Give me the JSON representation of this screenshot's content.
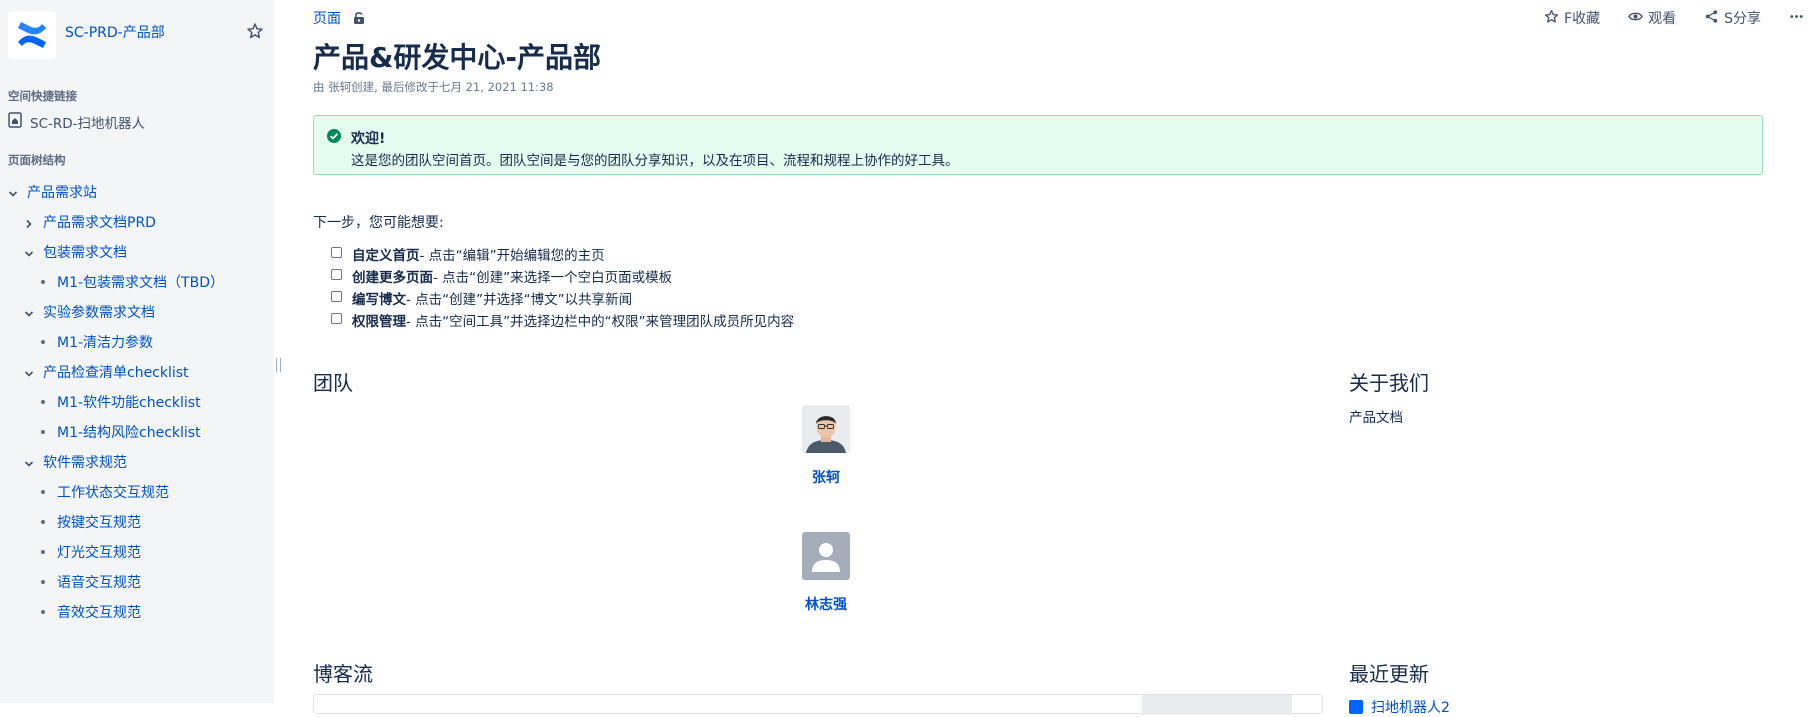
{
  "space": {
    "name": "SC-PRD-产品部",
    "logo_icon": "confluence-logo-icon"
  },
  "sidebar": {
    "shortcuts_heading": "空间快捷链接",
    "shortcut": {
      "label": "SC-RD-扫地机器人",
      "icon": "space-home-icon"
    },
    "tree_heading": "页面树结构",
    "tree": [
      {
        "label": "产品需求站",
        "level": 0,
        "marker": "chevron-down"
      },
      {
        "label": "产品需求文档PRD",
        "level": 1,
        "marker": "chevron-right"
      },
      {
        "label": "包装需求文档",
        "level": 1,
        "marker": "chevron-down"
      },
      {
        "label": "M1-包装需求文档（TBD）",
        "level": 2,
        "marker": "dot"
      },
      {
        "label": "实验参数需求文档",
        "level": 1,
        "marker": "chevron-down"
      },
      {
        "label": "M1-清洁力参数",
        "level": 2,
        "marker": "dot"
      },
      {
        "label": "产品检查清单checklist",
        "level": 1,
        "marker": "chevron-down"
      },
      {
        "label": "M1-软件功能checklist",
        "level": 2,
        "marker": "dot"
      },
      {
        "label": "M1-结构风险checklist",
        "level": 2,
        "marker": "dot"
      },
      {
        "label": "软件需求规范",
        "level": 1,
        "marker": "chevron-down"
      },
      {
        "label": "工作状态交互规范",
        "level": 2,
        "marker": "dot"
      },
      {
        "label": "按键交互规范",
        "level": 2,
        "marker": "dot"
      },
      {
        "label": "灯光交互规范",
        "level": 2,
        "marker": "dot"
      },
      {
        "label": "语音交互规范",
        "level": 2,
        "marker": "dot"
      },
      {
        "label": "音效交互规范",
        "level": 2,
        "marker": "dot"
      }
    ]
  },
  "breadcrumb": {
    "label": "页面"
  },
  "actions": {
    "save_label": "F收藏",
    "watch_label": "观看",
    "share_label": "S分享"
  },
  "page": {
    "title": "产品&研发中心-产品部",
    "byline": "由 张轲创建, 最后修改于七月 21, 2021 11:38"
  },
  "info_panel": {
    "title": "欢迎!",
    "text": "这是您的团队空间首页。团队空间是与您的团队分享知识，以及在项目、流程和规程上协作的好工具。"
  },
  "next_steps": {
    "heading": "下一步，您可能想要:",
    "tasks": [
      {
        "bold": "自定义首页",
        "rest": " - 点击“编辑”开始编辑您的主页"
      },
      {
        "bold": "创建更多页面",
        "rest": " - 点击“创建”来选择一个空白页面或模板"
      },
      {
        "bold": "编写博文",
        "rest": " - 点击“创建”并选择“博文”以共享新闻"
      },
      {
        "bold": "权限管理",
        "rest": " - 点击“空间工具”并选择边栏中的“权限”来管理团队成员所见内容"
      }
    ]
  },
  "team": {
    "heading": "团队",
    "members": [
      {
        "name": "张轲",
        "avatar": "photo"
      },
      {
        "name": "林志强",
        "avatar": "default"
      }
    ]
  },
  "about": {
    "heading": "关于我们",
    "text": "产品文档"
  },
  "blog": {
    "heading": "博客流"
  },
  "recent": {
    "heading": "最近更新",
    "first_item": "扫地机器人2"
  },
  "colors": {
    "link": "#0052cc",
    "text": "#172b4d",
    "sidebar_bg": "#f4f5f7",
    "success_bg": "#e3fcef",
    "success_border": "#9fd8b9",
    "success_icon": "#00875a"
  }
}
